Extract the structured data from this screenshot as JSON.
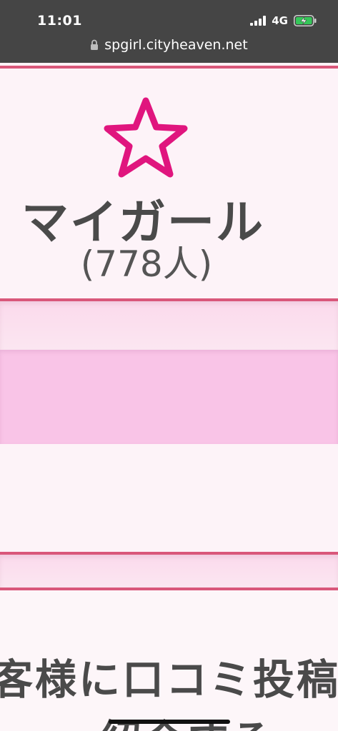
{
  "status_bar": {
    "time": "11:01",
    "network": "4G",
    "signal_icon": "signal-bars-icon",
    "battery_icon": "battery-charging-icon",
    "background": "#454545"
  },
  "browser": {
    "url": "spgirl.cityheaven.net",
    "lock_icon": "lock-icon"
  },
  "my_girl": {
    "icon": "star-outline-icon",
    "icon_color": "#e0157e",
    "title": "マイガール",
    "count": "(778人)"
  },
  "review": {
    "line1": "客様に口コミ投稿",
    "line2": "紹介する"
  },
  "colors": {
    "accent_line": "#d9577a",
    "band_strong": "#f9c4e7",
    "text": "#4a4a4a"
  }
}
